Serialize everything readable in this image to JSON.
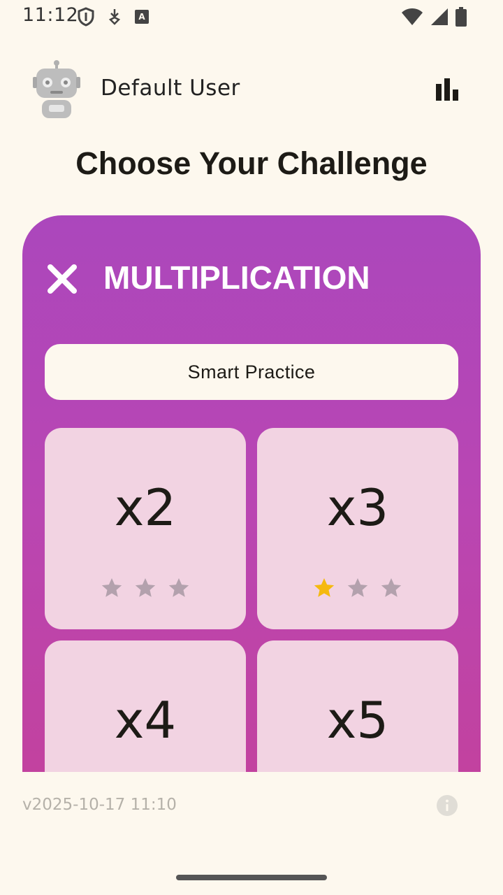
{
  "status_bar": {
    "time": "11:12",
    "icons_left": [
      "shield-icon",
      "download-icon",
      "font-icon"
    ],
    "icons_right": [
      "wifi-icon",
      "signal-icon",
      "battery-icon"
    ]
  },
  "header": {
    "user_name": "Default User",
    "avatar_icon": "robot-avatar-icon",
    "stats_icon": "bar-chart-icon"
  },
  "page_title": "Choose Your Challenge",
  "card": {
    "title": "MULTIPLICATION",
    "close_icon": "close-icon",
    "smart_practice_label": "Smart Practice",
    "tiles": [
      {
        "label": "x2",
        "stars_earned": 0,
        "stars_total": 3
      },
      {
        "label": "x3",
        "stars_earned": 1,
        "stars_total": 3
      },
      {
        "label": "x4"
      },
      {
        "label": "x5"
      }
    ]
  },
  "footer": {
    "version": "v2025-10-17 11:10",
    "info_icon": "info-icon"
  },
  "colors": {
    "background": "#fdf8ee",
    "card_gradient_top": "#ab47bc",
    "card_gradient_bottom": "#c2429f",
    "tile": "#f2d3e2",
    "star_filled": "#f5b90e",
    "star_empty": "#b3a1ad"
  }
}
